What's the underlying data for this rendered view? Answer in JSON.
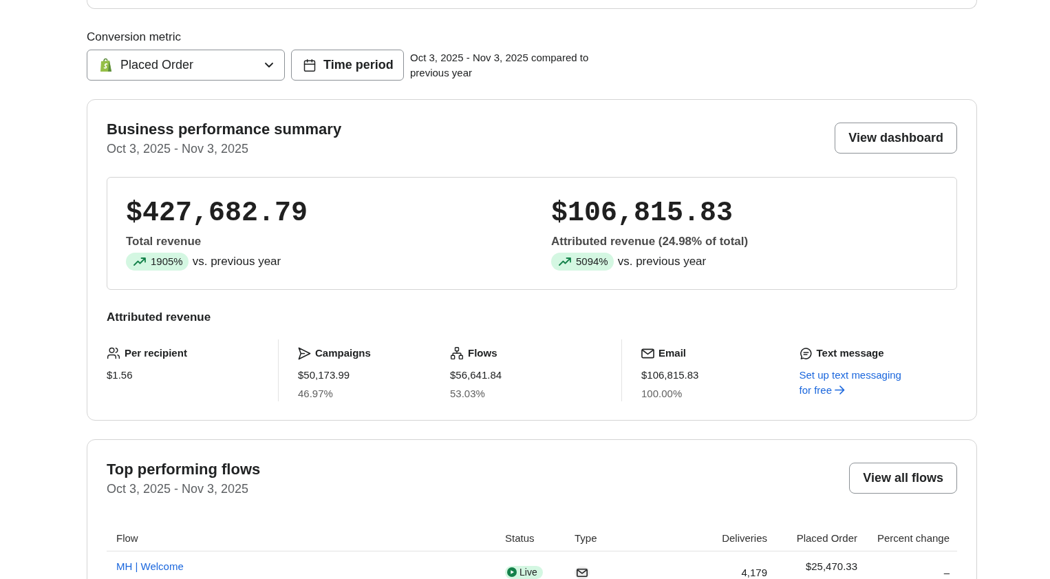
{
  "conversion_metric": {
    "label": "Conversion metric",
    "dropdown": {
      "value": "Placed Order"
    },
    "time_period_button": "Time period",
    "comparison_note": "Oct 3, 2025 - Nov 3, 2025 compared to previous year"
  },
  "business_summary": {
    "title": "Business performance summary",
    "date_range": "Oct 3, 2025 - Nov 3, 2025",
    "button": "View dashboard",
    "totals": [
      {
        "kind": "up",
        "amount": "$427,682.79",
        "label": "Total revenue",
        "change": "1905%",
        "change_note": "vs. previous year"
      },
      {
        "kind": "up",
        "amount": "$106,815.83",
        "label": "Attributed revenue (24.98% of total)",
        "change": "5094%",
        "change_note": "vs. previous year"
      }
    ],
    "attributed_heading": "Attributed revenue",
    "stat_groups": [
      {
        "items": [
          {
            "kind": "value",
            "label": "Per recipient",
            "value": "$1.56"
          }
        ]
      },
      {
        "items": [
          {
            "kind": "share",
            "label": "Campaigns",
            "value": "$50,173.99",
            "share": "46.97%"
          },
          {
            "kind": "share",
            "label": "Flows",
            "value": "$56,641.84",
            "share": "53.03%"
          }
        ]
      },
      {
        "items": [
          {
            "kind": "share",
            "label": "Email",
            "value": "$106,815.83",
            "share": "100.00%"
          },
          {
            "kind": "link",
            "label": "Text message",
            "link": "Set up text messaging for free"
          }
        ]
      }
    ]
  },
  "top_flows": {
    "title": "Top performing flows",
    "date_range": "Oct 3, 2025 - Nov 3, 2025",
    "button": "View all flows",
    "table": {
      "columns": [
        "Flow",
        "Status",
        "Type",
        "Deliveries",
        "Placed Order",
        "Percent change"
      ],
      "rows": [
        {
          "kind": "email",
          "flow": "MH | Welcome",
          "status": "Live",
          "deliveries": "4,179",
          "placed_order": "$25,470.33",
          "percent_change": "–"
        }
      ]
    }
  }
}
